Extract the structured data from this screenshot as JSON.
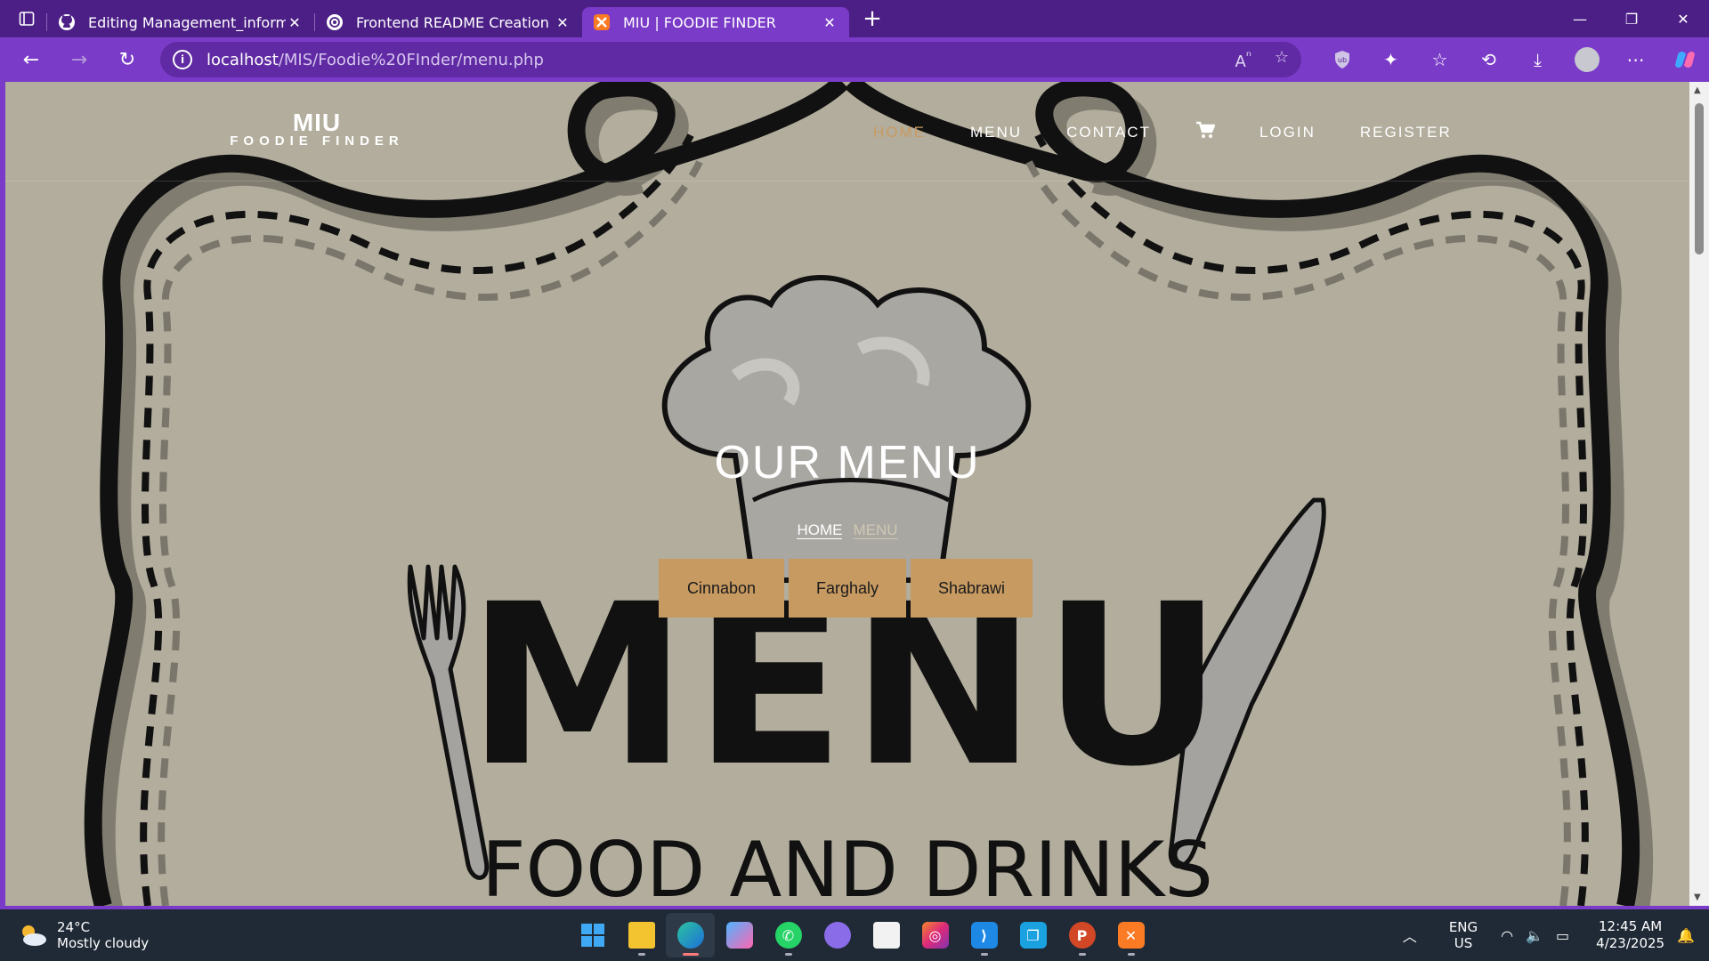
{
  "browser": {
    "tabs": [
      {
        "title": "Editing Management_information",
        "icon": "github-icon",
        "active": false
      },
      {
        "title": "Frontend README Creation",
        "icon": "chatgpt-icon",
        "active": false
      },
      {
        "title": "MIU | FOODIE FINDER",
        "icon": "xampp-icon",
        "active": true
      }
    ],
    "url_host": "localhost",
    "url_path": "/MIS/Foodie%20FInder/menu.php"
  },
  "site": {
    "brand_main": "MIU",
    "brand_sub": "FOODIE FINDER",
    "nav": {
      "home": "HOME",
      "menu": "MENU",
      "contact": "CONTACT",
      "login": "LOGIN",
      "register": "REGISTER"
    },
    "hero_title": "OUR MENU",
    "breadcrumb": {
      "home": "HOME",
      "current": "MENU"
    },
    "filters": [
      "Cinnabon",
      "Farghaly",
      "Shabrawi"
    ],
    "art_word_1": "MENU",
    "art_word_2": "FOOD AND DRINKS"
  },
  "taskbar": {
    "weather_temp": "24°C",
    "weather_desc": "Mostly cloudy",
    "lang_1": "ENG",
    "lang_2": "US",
    "time": "12:45 AM",
    "date": "4/23/2025"
  },
  "colors": {
    "chrome_purple": "#7a3bc8",
    "tab_bar": "#4c1f86",
    "page_bg": "#b2ad9c",
    "accent": "#c79a62"
  }
}
